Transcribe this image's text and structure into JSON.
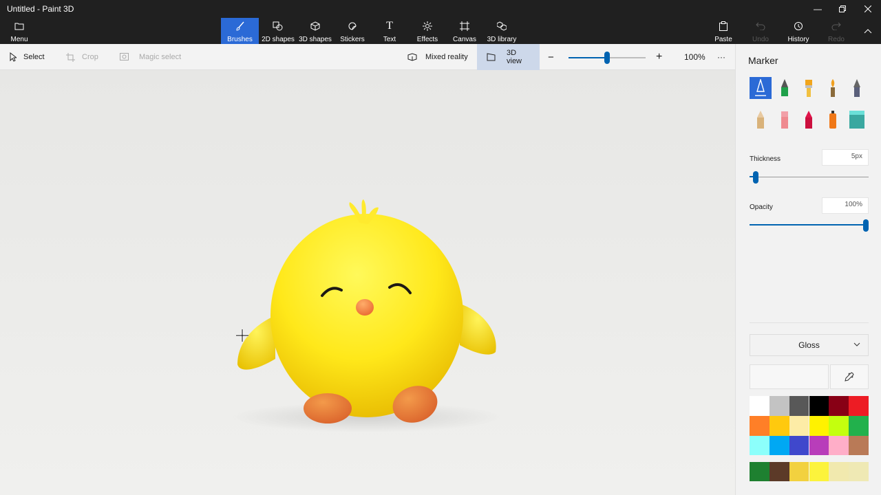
{
  "window": {
    "title": "Untitled - Paint 3D"
  },
  "ribbon": {
    "menu_label": "Menu",
    "tools": [
      {
        "label": "Brushes",
        "icon": "brush-icon",
        "active": true
      },
      {
        "label": "2D shapes",
        "icon": "2d-shapes-icon"
      },
      {
        "label": "3D shapes",
        "icon": "3d-shapes-icon"
      },
      {
        "label": "Stickers",
        "icon": "stickers-icon"
      },
      {
        "label": "Text",
        "icon": "text-icon"
      },
      {
        "label": "Effects",
        "icon": "effects-icon"
      },
      {
        "label": "Canvas",
        "icon": "canvas-icon"
      },
      {
        "label": "3D library",
        "icon": "3d-library-icon"
      }
    ],
    "right_actions": [
      {
        "label": "Paste",
        "icon": "paste-icon",
        "enabled": true
      },
      {
        "label": "Undo",
        "icon": "undo-icon",
        "enabled": false
      },
      {
        "label": "History",
        "icon": "history-icon",
        "enabled": true
      },
      {
        "label": "Redo",
        "icon": "redo-icon",
        "enabled": false
      }
    ]
  },
  "toolbar": {
    "select_label": "Select",
    "crop_label": "Crop",
    "magic_select_label": "Magic select",
    "mixed_reality_label": "Mixed reality",
    "view3d_label": "3D view",
    "zoom_value": "100%",
    "zoom_level": 0.5,
    "more_label": "···"
  },
  "panel": {
    "title": "Marker",
    "brushes": [
      {
        "name": "marker-brush-icon",
        "active": true
      },
      {
        "name": "calligraphy-pen-icon"
      },
      {
        "name": "oil-brush-icon"
      },
      {
        "name": "watercolor-icon"
      },
      {
        "name": "pixel-pen-icon"
      },
      {
        "name": "pencil-icon"
      },
      {
        "name": "eraser-icon"
      },
      {
        "name": "crayon-icon"
      },
      {
        "name": "spray-can-icon"
      },
      {
        "name": "fill-bucket-icon"
      }
    ],
    "thickness_label": "Thickness",
    "thickness_value": "5px",
    "thickness_level": 0.05,
    "opacity_label": "Opacity",
    "opacity_value": "100%",
    "opacity_level": 1.0,
    "finish_value": "Gloss",
    "accent_color": "#0063b1",
    "palette": [
      "#ffffff",
      "#c3c3c3",
      "#585858",
      "#000000",
      "#880015",
      "#ed1c24",
      "#ff7f27",
      "#ffc90e",
      "#fdeca6",
      "#fff200",
      "#c4ff0e",
      "#22b14c",
      "#8cfffb",
      "#00a8f3",
      "#3f48cc",
      "#b83dba",
      "#ffaec8",
      "#b97a57"
    ],
    "custom_colors": [
      "#1e8030",
      "#5c3a28",
      "#f2d13f",
      "#fcf33c",
      "#f1e9ae",
      "#efe9b4"
    ]
  }
}
